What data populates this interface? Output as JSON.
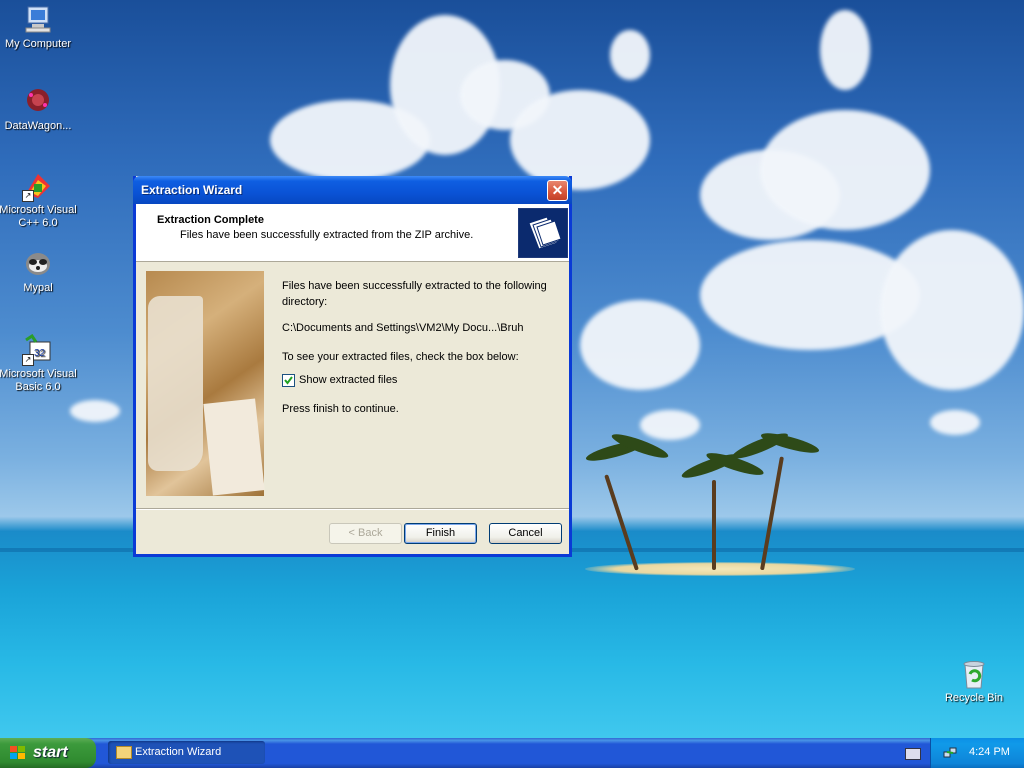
{
  "desktop": {
    "icons": [
      {
        "label": "My Computer"
      },
      {
        "label": "DataWagon..."
      },
      {
        "label": "Microsoft Visual C++ 6.0"
      },
      {
        "label": "Mypal"
      },
      {
        "label": "Microsoft Visual Basic 6.0"
      },
      {
        "label": "Recycle Bin"
      }
    ]
  },
  "dialog": {
    "title": "Extraction Wizard",
    "close_label": "✕",
    "header_title": "Extraction Complete",
    "header_subtitle": "Files have been successfully extracted from the ZIP archive.",
    "body_line1": "Files have been successfully extracted to the following",
    "body_line2": "directory:",
    "path": "C:\\Documents and Settings\\VM2\\My Docu...\\Bruh",
    "check_prompt": "To see your extracted files, check the box below:",
    "checkbox_label": "Show extracted files",
    "checkbox_checked": true,
    "continue_text": "Press finish to continue.",
    "buttons": {
      "back": "< Back",
      "finish": "Finish",
      "cancel": "Cancel"
    }
  },
  "taskbar": {
    "start_label": "start",
    "task_label": "Extraction Wizard",
    "clock": "4:24 PM"
  }
}
